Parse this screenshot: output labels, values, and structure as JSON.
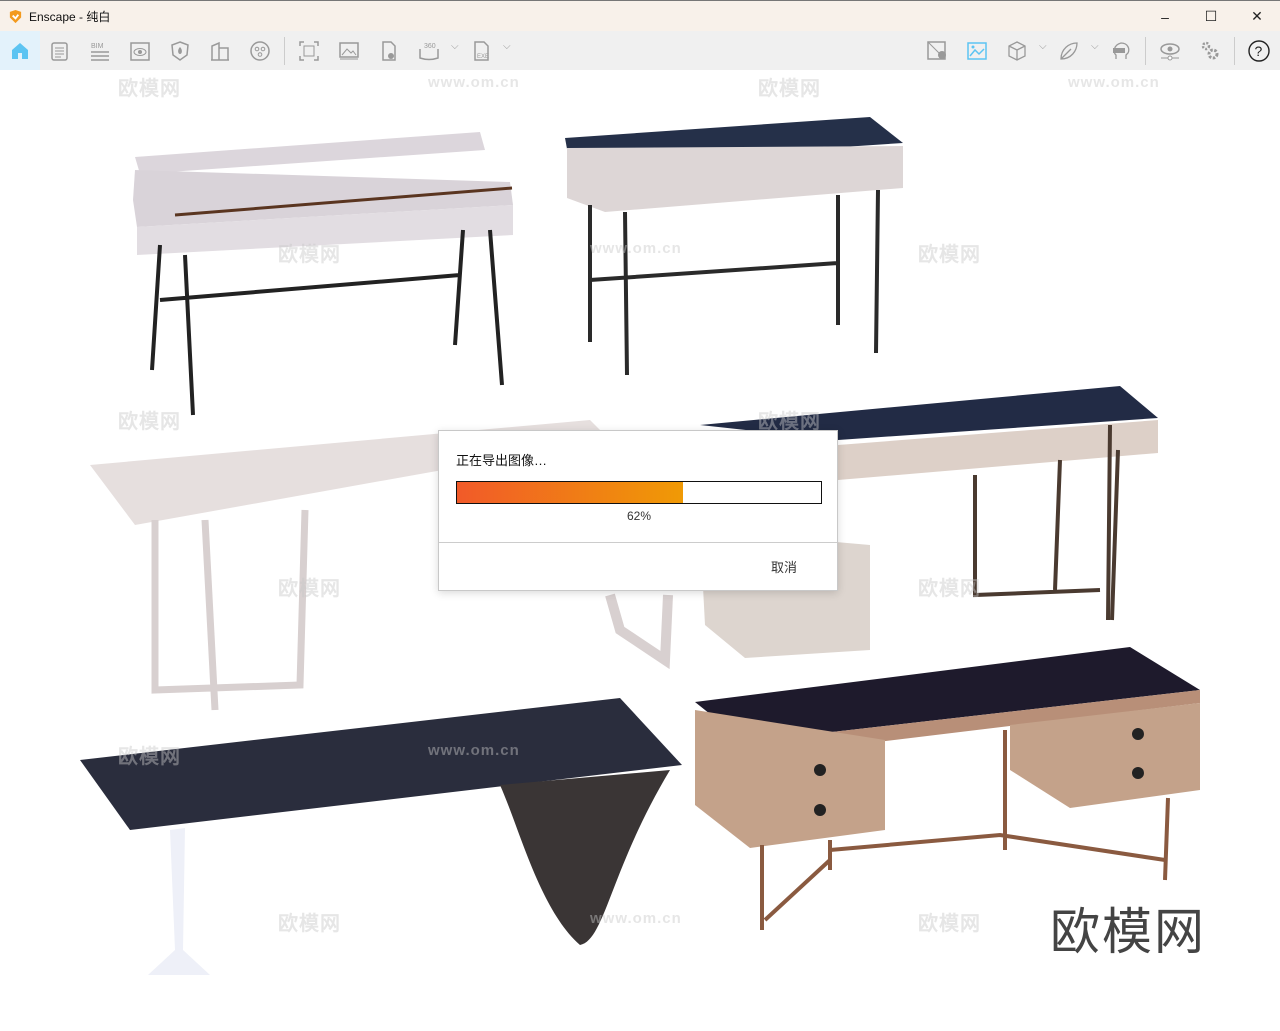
{
  "window": {
    "title": "Enscape - 纯白",
    "minimize": "–",
    "maximize": "☐",
    "close": "✕"
  },
  "toolbar": {
    "left": [
      "home",
      "views",
      "bim",
      "visual-settings",
      "site-context",
      "buildings",
      "video"
    ],
    "export": [
      "screenshot",
      "render-image",
      "batch-render",
      "panorama-360",
      "exe-export"
    ],
    "right": [
      "map",
      "view-image",
      "asset-library",
      "material-editor",
      "vr-headset",
      "visual-settings-eye",
      "settings"
    ],
    "panorama_label": "360",
    "exe_label": "EXE",
    "bim_label": "BIM",
    "help": "?",
    "collapse": "^"
  },
  "viewport": {
    "watermarks": [
      "欧模网",
      "www.om.cn"
    ],
    "brand": "欧模网"
  },
  "dialog": {
    "message": "正在导出图像…",
    "progress_percent": 62,
    "progress_label": "62%",
    "cancel": "取消",
    "colors": {
      "start": "#f15a29",
      "end": "#f09a05"
    }
  }
}
